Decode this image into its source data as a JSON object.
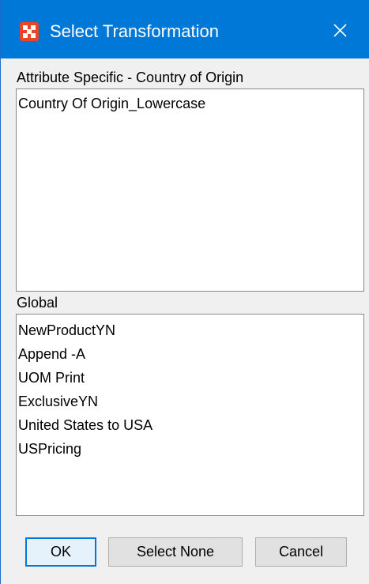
{
  "window": {
    "title": "Select Transformation",
    "app_icon": "app-logo-icon",
    "close_icon": "close-icon"
  },
  "attribute_section": {
    "label": "Attribute Specific - Country of Origin",
    "items": [
      "Country Of Origin_Lowercase"
    ]
  },
  "global_section": {
    "label": "Global",
    "items": [
      "NewProductYN",
      "Append -A",
      "UOM Print",
      "ExclusiveYN",
      "United States to USA",
      "USPricing"
    ]
  },
  "buttons": {
    "ok": "OK",
    "select_none": "Select None",
    "cancel": "Cancel"
  },
  "colors": {
    "titlebar": "#0078d7",
    "app_icon": "#e8462a",
    "default_button_border": "#0078d7"
  }
}
